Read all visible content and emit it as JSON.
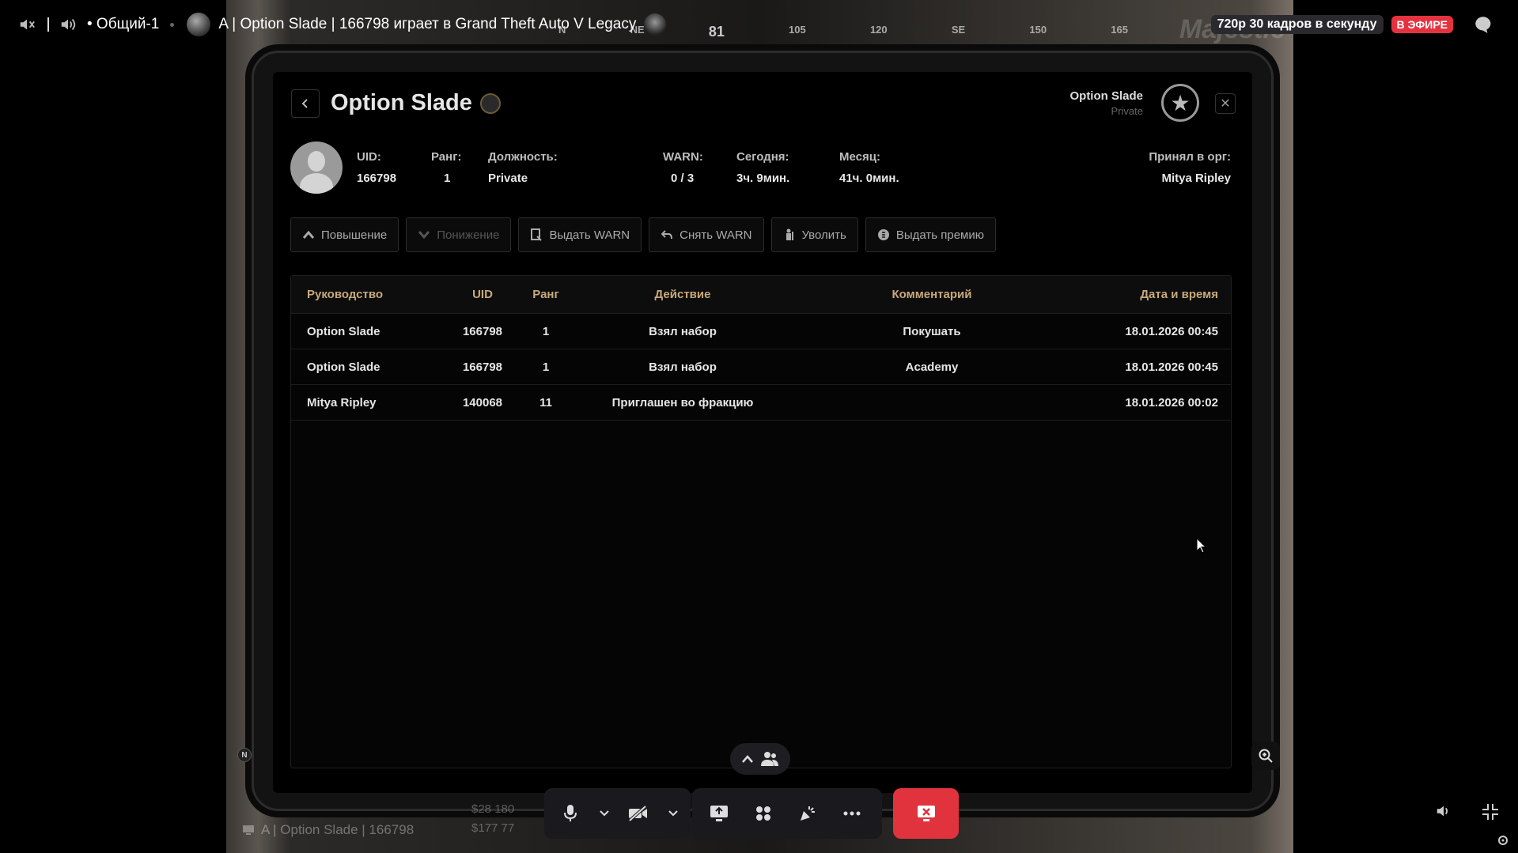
{
  "topbar": {
    "channel": "• Общий-1",
    "stream_title": "A | Option Slade | 166798 играет в Grand Theft Auto V Legacy",
    "quality": "720p 30 кадров в секунду",
    "live_badge": "В ЭФИРЕ",
    "icons": [
      "speaker-muted-icon",
      "volume-icon",
      "avatar",
      "game-icon",
      "chat-icon"
    ]
  },
  "hud": {
    "compass": [
      "N",
      "NE",
      "81",
      "105",
      "120",
      "SE",
      "150",
      "165"
    ]
  },
  "profile": {
    "title": "Option Slade",
    "owner_name": "Option Slade",
    "owner_rank": "Private",
    "stats": {
      "uid_label": "UID:",
      "uid": "166798",
      "rank_label": "Ранг:",
      "rank": "1",
      "position_label": "Должность:",
      "position": "Private",
      "warn_label": "WARN:",
      "warn": "0 / 3",
      "today_label": "Сегодня:",
      "today": "3ч. 9мин.",
      "month_label": "Месяц:",
      "month": "41ч. 0мин.",
      "accepted_label": "Принял в орг:",
      "accepted_by": "Mitya Ripley"
    }
  },
  "actions": [
    {
      "label": "Повышение",
      "icon": "chevron-up-icon",
      "enabled": true
    },
    {
      "label": "Понижение",
      "icon": "chevron-down-icon",
      "enabled": false
    },
    {
      "label": "Выдать WARN",
      "icon": "warn-doc-icon",
      "enabled": true
    },
    {
      "label": "Снять WARN",
      "icon": "undo-icon",
      "enabled": true
    },
    {
      "label": "Уволить",
      "icon": "fire-person-icon",
      "enabled": true
    },
    {
      "label": "Выдать премию",
      "icon": "coin-icon",
      "enabled": true
    }
  ],
  "table": {
    "headers": [
      "Руководство",
      "UID",
      "Ранг",
      "Действие",
      "Комментарий",
      "Дата и время"
    ],
    "rows": [
      [
        "Option Slade",
        "166798",
        "1",
        "Взял набор",
        "Покушать",
        "18.01.2026 00:45"
      ],
      [
        "Option Slade",
        "166798",
        "1",
        "Взял набор",
        "Academy",
        "18.01.2026 00:45"
      ],
      [
        "Mitya Ripley",
        "140068",
        "11",
        "Приглашен во фракцию",
        "",
        "18.01.2026 00:02"
      ]
    ]
  },
  "overlay": {
    "n_badge": "N",
    "bottom_title": "A | Option Slade | 166798",
    "money_top": "$28 180",
    "money_bottom": "$177 77"
  },
  "brand_watermark": "Majestic",
  "colors": {
    "accent_gold": "#c8a97b",
    "live_red": "#e5323f",
    "end_call_red": "#e0333e"
  }
}
